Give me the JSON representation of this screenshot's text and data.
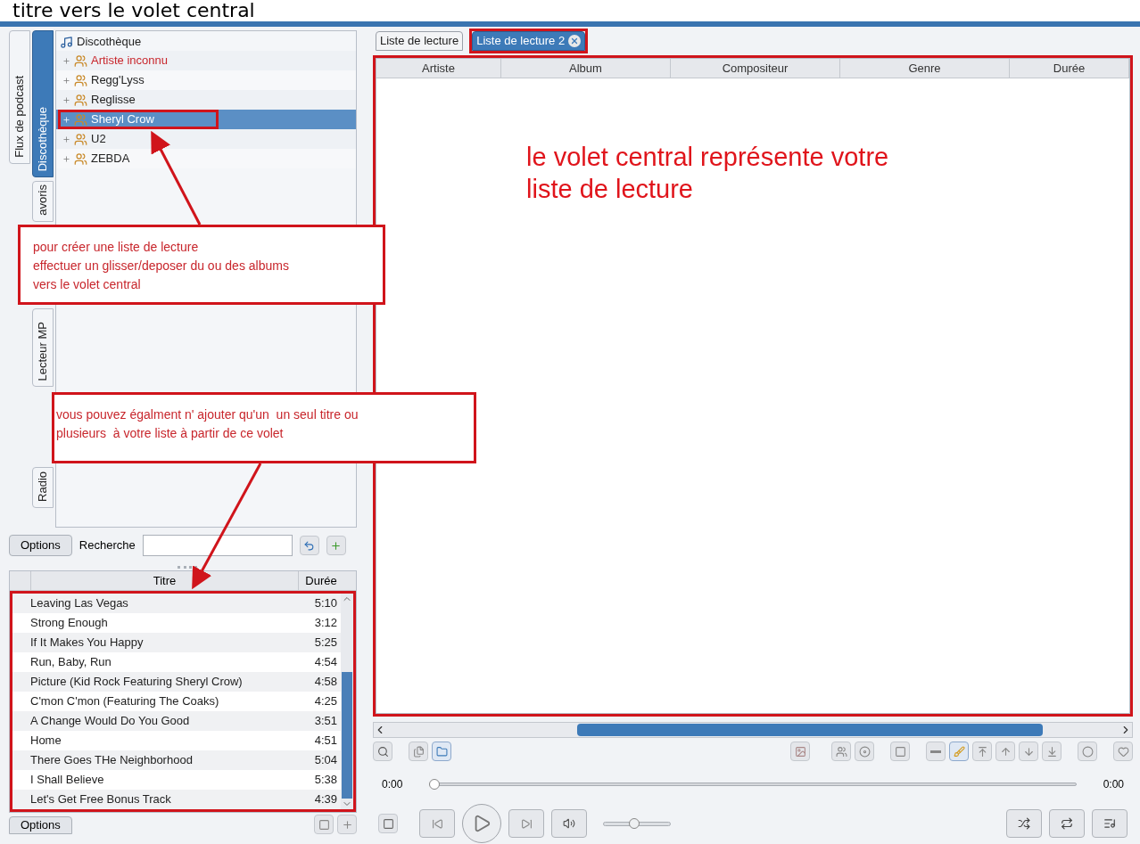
{
  "caption": "titre vers le volet central",
  "side_tabs": [
    {
      "label": "Flux de podcast",
      "selected": false
    },
    {
      "label": "Discothèque",
      "selected": true
    },
    {
      "label": "avoris",
      "selected": false
    },
    {
      "label": "Lecteur MP",
      "selected": false
    },
    {
      "label": "Radio",
      "selected": false
    }
  ],
  "tree": {
    "root": "Discothèque",
    "children": [
      {
        "label": "Artiste inconnu",
        "kind": "unknown",
        "selected": false,
        "highlighted": false
      },
      {
        "label": "Regg'Lyss",
        "kind": "artist",
        "selected": false,
        "highlighted": false
      },
      {
        "label": "Reglisse",
        "kind": "artist",
        "selected": false,
        "highlighted": false
      },
      {
        "label": "Sheryl Crow",
        "kind": "artist",
        "selected": true,
        "highlighted": true
      },
      {
        "label": "U2",
        "kind": "artist",
        "selected": false,
        "highlighted": false
      },
      {
        "label": "ZEBDA",
        "kind": "artist",
        "selected": false,
        "highlighted": false
      }
    ]
  },
  "search": {
    "options": "Options",
    "label": "Recherche"
  },
  "track_list": {
    "columns": [
      "Titre",
      "Durée"
    ],
    "highlighted": true,
    "rows": [
      {
        "title": "Leaving Las Vegas",
        "duration": "5:10"
      },
      {
        "title": "Strong Enough",
        "duration": "3:12"
      },
      {
        "title": "If It Makes You Happy",
        "duration": "5:25"
      },
      {
        "title": "Run, Baby, Run",
        "duration": "4:54"
      },
      {
        "title": "Picture (Kid Rock Featuring Sheryl Crow)",
        "duration": "4:58"
      },
      {
        "title": "C'mon C'mon (Featuring The Coaks)",
        "duration": "4:25"
      },
      {
        "title": "A Change Would Do You Good",
        "duration": "3:51"
      },
      {
        "title": "Home",
        "duration": "4:51"
      },
      {
        "title": "There Goes THe Neighborhood",
        "duration": "5:04"
      },
      {
        "title": "I Shall Believe",
        "duration": "5:38"
      },
      {
        "title": "Let's Get Free Bonus Track",
        "duration": "4:39"
      }
    ],
    "options": "Options"
  },
  "playlist_tabs": [
    {
      "label": "Liste de lecture",
      "selected": false,
      "closable": false,
      "highlighted": false
    },
    {
      "label": "Liste de lecture 2",
      "selected": true,
      "closable": true,
      "highlighted": true
    }
  ],
  "playlist": {
    "columns": [
      "Artiste",
      "Album",
      "Compositeur",
      "Genre",
      "Durée"
    ],
    "highlighted": true
  },
  "player": {
    "elapsed": "0:00",
    "total": "0:00",
    "position": {
      "level": 0
    },
    "volume": {
      "level": 0.45
    }
  },
  "notes": {
    "central": "le volet central représente votre liste de lecture",
    "create": [
      "pour créer une liste de lecture",
      "effectuer un glisser/deposer du ou des albums",
      "vers le volet central"
    ],
    "single": [
      "vous pouvez égalment n' ajouter qu'un  un seul titre ou",
      "plusieurs  à votre liste à partir de ce volet"
    ]
  }
}
